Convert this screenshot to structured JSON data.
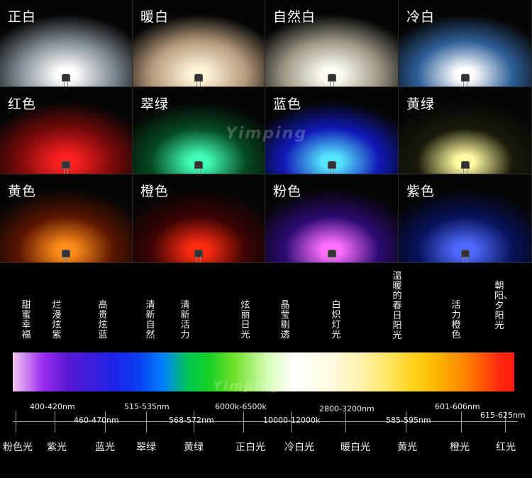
{
  "tiles": [
    {
      "label": "正白",
      "bg": "#7f8b93",
      "glow": "#ffffff"
    },
    {
      "label": "暖白",
      "bg": "#b69a7c",
      "glow": "#fff4d8"
    },
    {
      "label": "自然白",
      "bg": "#9f9886",
      "glow": "#fffef3"
    },
    {
      "label": "冷白",
      "bg": "#2e5f98",
      "glow": "#ffffff"
    },
    {
      "label": "红色",
      "bg": "#7a0a0a",
      "glow": "#ff2020"
    },
    {
      "label": "翠绿",
      "bg": "#054b20",
      "glow": "#42ffb8"
    },
    {
      "label": "蓝色",
      "bg": "#1119b8",
      "glow": "#55e6ff"
    },
    {
      "label": "黄绿",
      "bg": "#1a1a0a",
      "glow": "#fffba0"
    },
    {
      "label": "黄色",
      "bg": "#5a1500",
      "glow": "#ff8c1a"
    },
    {
      "label": "橙色",
      "bg": "#3b0404",
      "glow": "#ff2a10"
    },
    {
      "label": "粉色",
      "bg": "#2b0a70",
      "glow": "#ff70ff"
    },
    {
      "label": "紫色",
      "bg": "#07125a",
      "glow": "#4f6bff"
    }
  ],
  "watermark": "Yimping",
  "descriptors": [
    "甜蜜幸福",
    "烂漫炫紫",
    "高贵炫蓝",
    "清新自然",
    "清新活力",
    "炫丽日光",
    "晶莹剔透",
    "白炽灯光",
    "温暖的春日阳光",
    "活力橙色",
    "朝阳、夕阳光"
  ],
  "ranges": [
    "400-420nm",
    "460-470nm",
    "515-535nm",
    "568-572nm",
    "6000k-6500k",
    "10000-12000k",
    "2800-3200nm",
    "585-595nm",
    "601-606nm",
    "615-625nm"
  ],
  "color_names": [
    "粉色光",
    "紫光",
    "蓝光",
    "翠绿",
    "黄绿",
    "正白光",
    "冷白光",
    "暖白光",
    "黄光",
    "橙光",
    "红光"
  ]
}
